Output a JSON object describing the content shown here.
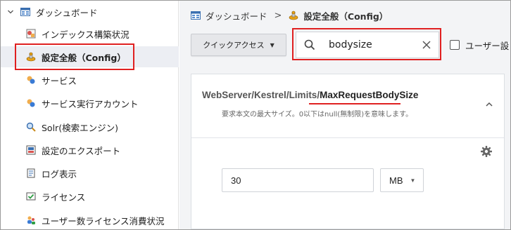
{
  "sidebar": {
    "items": [
      {
        "label": "ダッシュボード",
        "icon": "dashboard-icon"
      },
      {
        "label": "インデックス構築状況",
        "icon": "index-status-icon"
      },
      {
        "label": "設定全般（Config）",
        "icon": "config-icon"
      },
      {
        "label": "サービス",
        "icon": "service-icon"
      },
      {
        "label": "サービス実行アカウント",
        "icon": "service-account-icon"
      },
      {
        "label": "Solr(検索エンジン)",
        "icon": "search-engine-icon"
      },
      {
        "label": "設定のエクスポート",
        "icon": "export-icon"
      },
      {
        "label": "ログ表示",
        "icon": "log-icon"
      },
      {
        "label": "ライセンス",
        "icon": "license-icon"
      },
      {
        "label": "ユーザー数ライセンス消費状況",
        "icon": "user-license-icon"
      }
    ]
  },
  "breadcrumb": {
    "root": "ダッシュボード",
    "separator": ">",
    "current": "設定全般（Config）"
  },
  "toolbar": {
    "quick_access_label": "クイックアクセス",
    "search_value": "bodysize",
    "checkbox_label": "ユーザー設"
  },
  "setting": {
    "key_prefix": "WebServer/Kestrel/Limits/",
    "key_leaf": "MaxRequestBodySize",
    "description": "要求本文の最大サイズ。0以下はnull(無制限)を意味します。",
    "value": "30",
    "unit": "MB"
  },
  "colors": {
    "highlight": "#e02020",
    "active_bg": "#eceef3",
    "main_bg": "#f3f4f6"
  }
}
